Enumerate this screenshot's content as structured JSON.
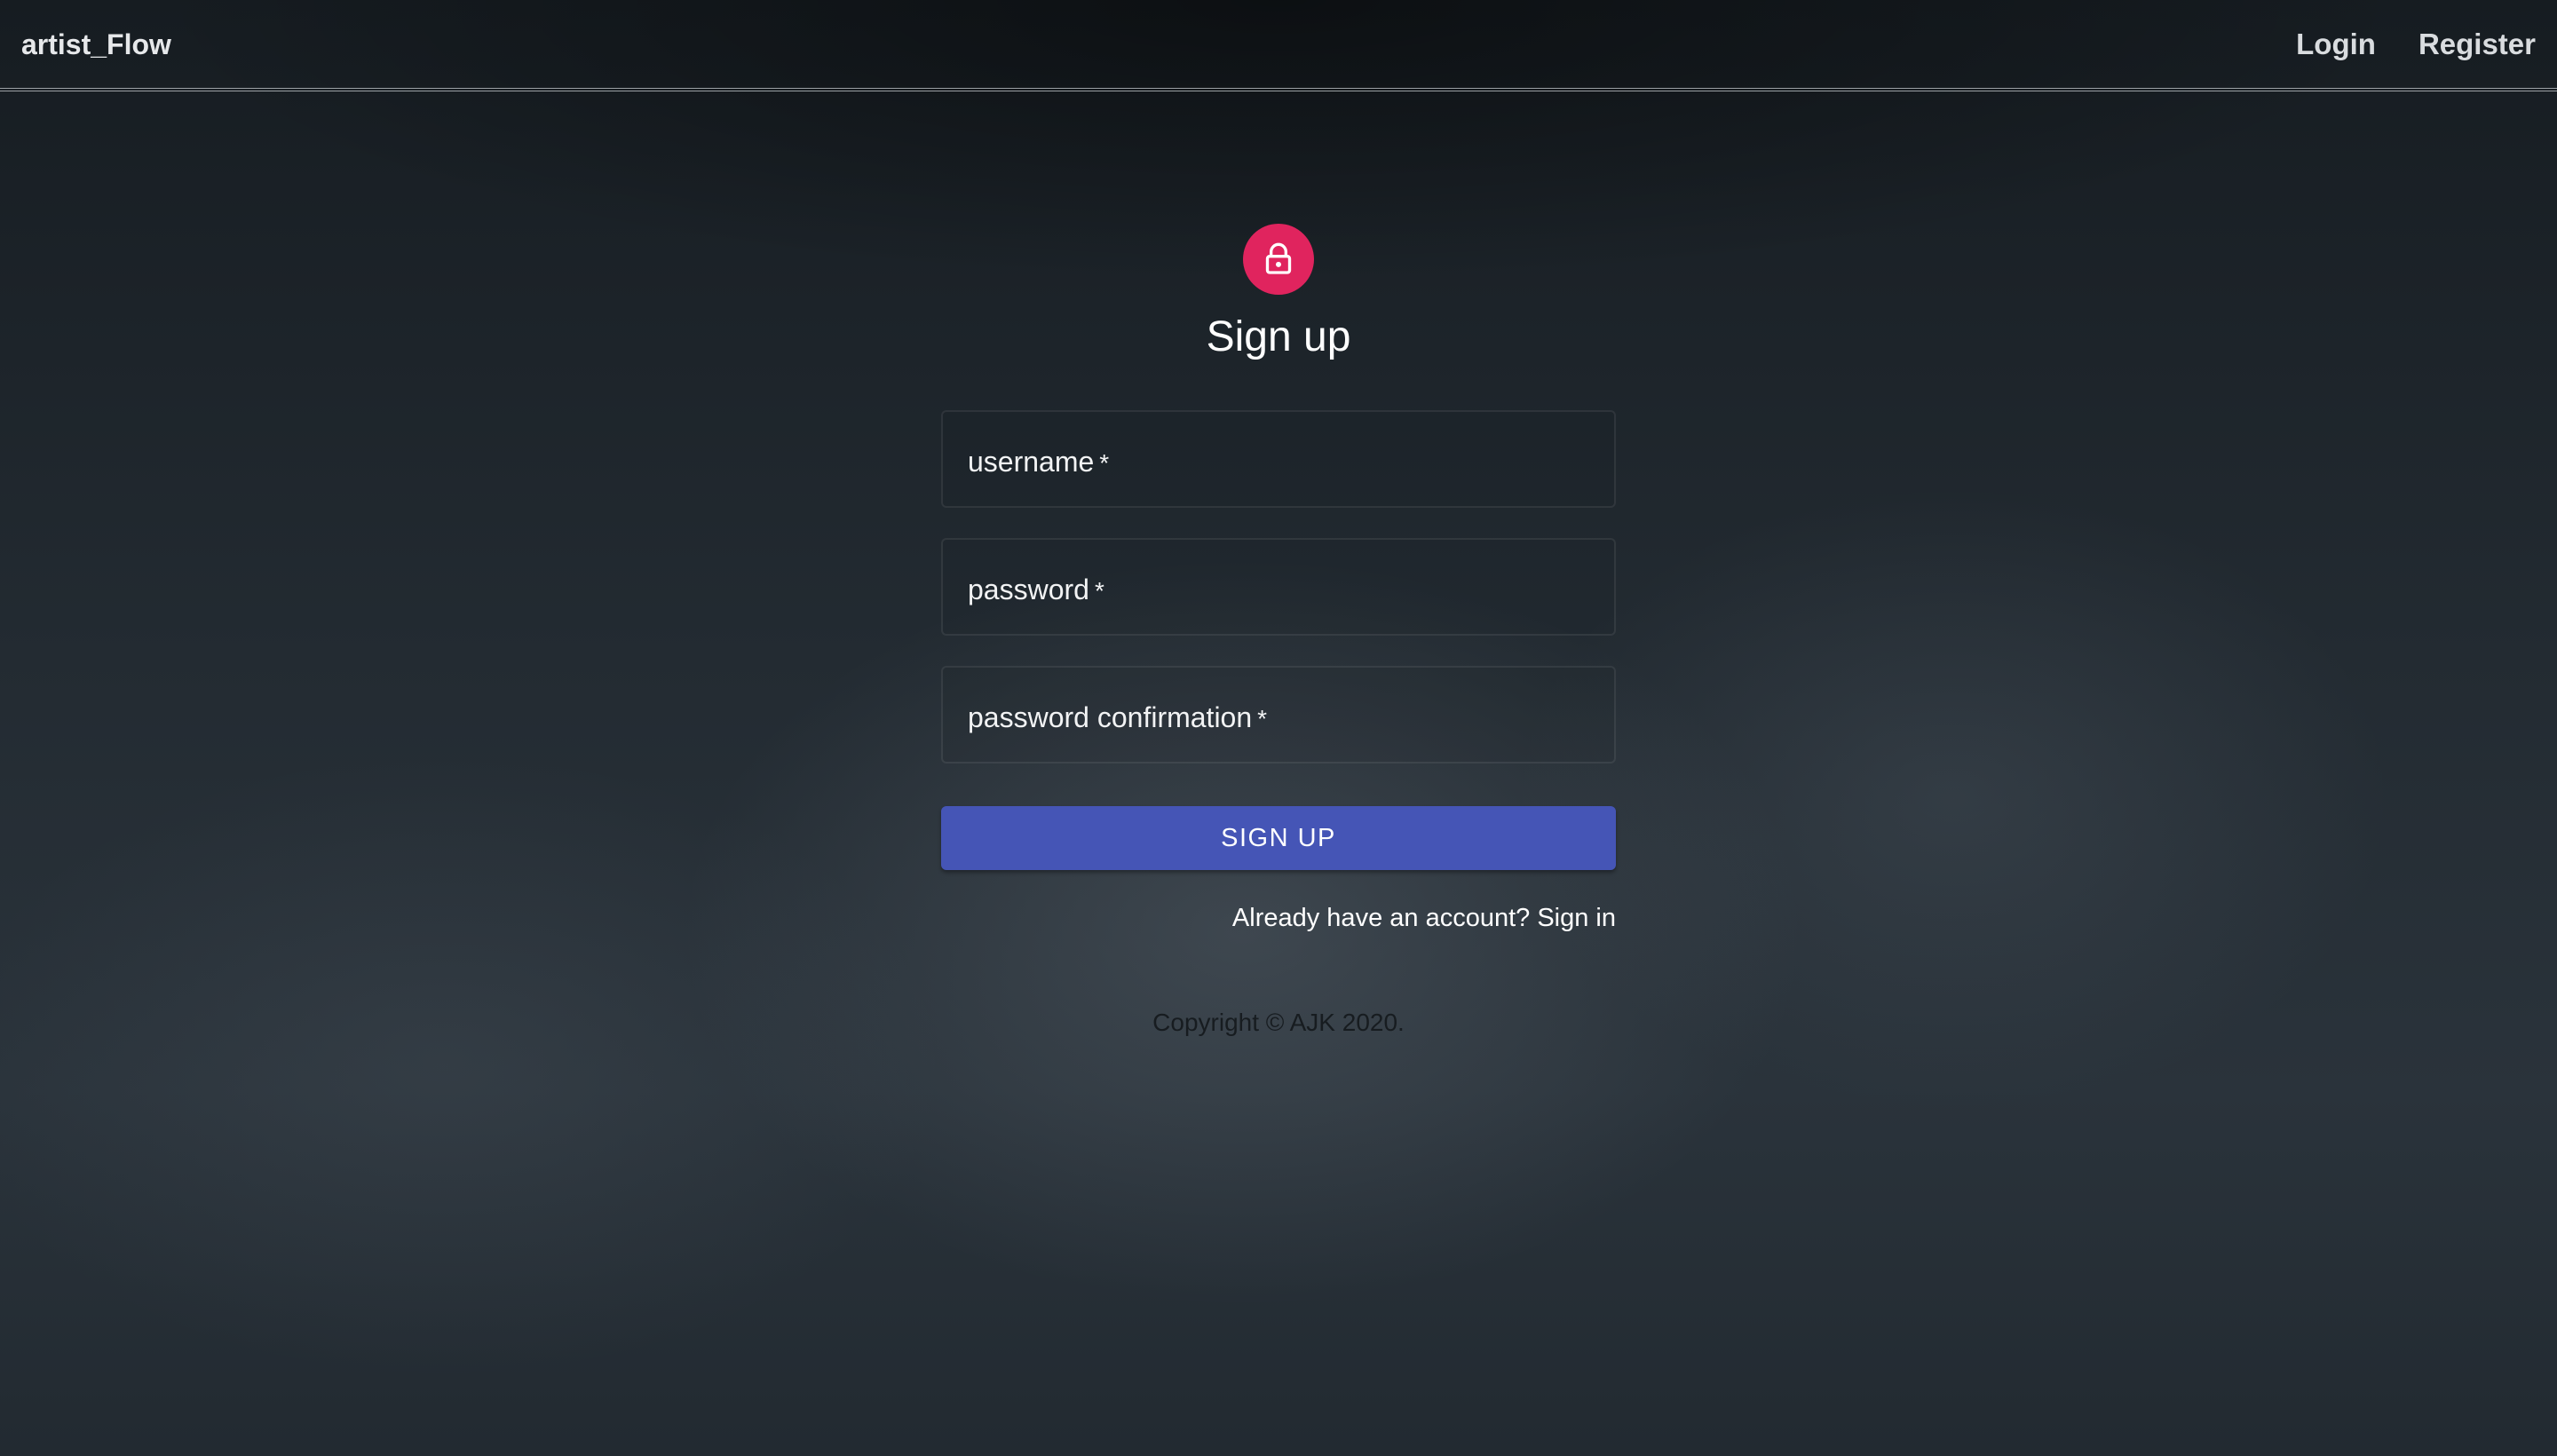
{
  "navbar": {
    "brand": "artist_Flow",
    "links": [
      {
        "label": "Login"
      },
      {
        "label": "Register"
      }
    ]
  },
  "form": {
    "icon": "lock-icon",
    "title": "Sign up",
    "fields": [
      {
        "label": "username",
        "required_mark": "*"
      },
      {
        "label": "password",
        "required_mark": "*"
      },
      {
        "label": "password confirmation",
        "required_mark": "*"
      }
    ],
    "submit_label": "SIGN UP",
    "signin_link": "Already have an account? Sign in"
  },
  "footer": {
    "copyright": "Copyright © AJK 2020."
  },
  "colors": {
    "accent": "#4555b6",
    "avatar": "#e0245e"
  }
}
